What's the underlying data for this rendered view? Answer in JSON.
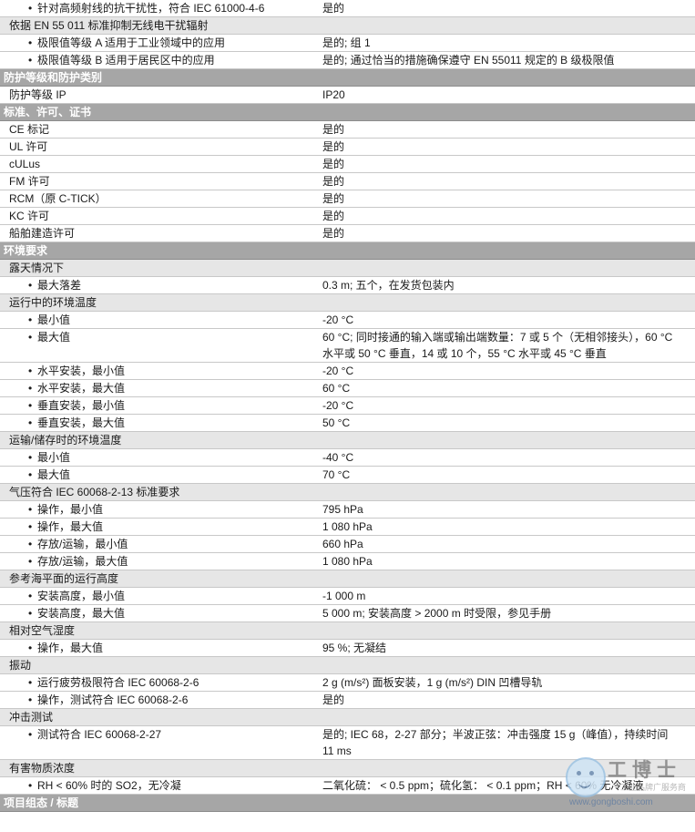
{
  "rows": [
    {
      "kind": "item",
      "label": "针对高频射线的抗干扰性，符合 IEC 61000-4-6",
      "value": "是的"
    },
    {
      "kind": "sub",
      "label": "依据 EN 55 011 标准抑制无线电干扰辐射",
      "value": ""
    },
    {
      "kind": "item",
      "label": "极限值等级 A 适用于工业领域中的应用",
      "value": "是的; 组 1"
    },
    {
      "kind": "item",
      "label": "极限值等级 B 适用于居民区中的应用",
      "value": "是的; 通过恰当的措施确保遵守 EN 55011 规定的 B 级极限值"
    },
    {
      "kind": "sec",
      "label": "防护等级和防护类别",
      "value": ""
    },
    {
      "kind": "plain",
      "label": "防护等级 IP",
      "value": "IP20"
    },
    {
      "kind": "sec",
      "label": "标准、许可、证书",
      "value": ""
    },
    {
      "kind": "plain",
      "label": "CE 标记",
      "value": "是的"
    },
    {
      "kind": "plain",
      "label": "UL 许可",
      "value": "是的"
    },
    {
      "kind": "plain",
      "label": "cULus",
      "value": "是的"
    },
    {
      "kind": "plain",
      "label": "FM 许可",
      "value": "是的"
    },
    {
      "kind": "plain",
      "label": "RCM（原 C-TICK）",
      "value": "是的"
    },
    {
      "kind": "plain",
      "label": "KC 许可",
      "value": "是的"
    },
    {
      "kind": "plain",
      "label": "船舶建造许可",
      "value": "是的"
    },
    {
      "kind": "sec",
      "label": "环境要求",
      "value": ""
    },
    {
      "kind": "sub",
      "label": "露天情况下",
      "value": ""
    },
    {
      "kind": "item",
      "label": "最大落差",
      "value": "0.3 m; 五个，在发货包装内"
    },
    {
      "kind": "sub",
      "label": "运行中的环境温度",
      "value": ""
    },
    {
      "kind": "item",
      "label": "最小值",
      "value": "-20 °C"
    },
    {
      "kind": "item",
      "label": "最大值",
      "value": "60 °C; 同时接通的输入端或输出端数量：7 或 5 个（无相邻接头），60 °C 水平或 50 °C 垂直，14 或 10 个，55 °C 水平或 45 °C 垂直"
    },
    {
      "kind": "item",
      "label": "水平安装，最小值",
      "value": "-20 °C"
    },
    {
      "kind": "item",
      "label": "水平安装，最大值",
      "value": "60 °C"
    },
    {
      "kind": "item",
      "label": "垂直安装，最小值",
      "value": "-20 °C"
    },
    {
      "kind": "item",
      "label": "垂直安装，最大值",
      "value": "50 °C"
    },
    {
      "kind": "sub",
      "label": "运输/储存时的环境温度",
      "value": ""
    },
    {
      "kind": "item",
      "label": "最小值",
      "value": "-40 °C"
    },
    {
      "kind": "item",
      "label": "最大值",
      "value": "70 °C"
    },
    {
      "kind": "sub",
      "label": "气压符合 IEC 60068-2-13 标准要求",
      "value": ""
    },
    {
      "kind": "item",
      "label": "操作，最小值",
      "value": "795 hPa"
    },
    {
      "kind": "item",
      "label": "操作，最大值",
      "value": "1 080 hPa"
    },
    {
      "kind": "item",
      "label": "存放/运输，最小值",
      "value": "660 hPa"
    },
    {
      "kind": "item",
      "label": "存放/运输，最大值",
      "value": "1 080 hPa"
    },
    {
      "kind": "sub",
      "label": "参考海平面的运行高度",
      "value": ""
    },
    {
      "kind": "item",
      "label": "安装高度，最小值",
      "value": "-1 000 m"
    },
    {
      "kind": "item",
      "label": "安装高度，最大值",
      "value": "5 000 m; 安装高度 > 2000 m 时受限，参见手册"
    },
    {
      "kind": "sub",
      "label": "相对空气湿度",
      "value": ""
    },
    {
      "kind": "item",
      "label": "操作，最大值",
      "value": "95 %; 无凝结"
    },
    {
      "kind": "sub",
      "label": "振动",
      "value": ""
    },
    {
      "kind": "item",
      "label": "运行疲劳极限符合 IEC 60068-2-6",
      "value": "2 g (m/s²) 面板安装，1 g (m/s²) DIN 凹槽导轨"
    },
    {
      "kind": "item",
      "label": "操作，测试符合 IEC 60068-2-6",
      "value": "是的"
    },
    {
      "kind": "sub",
      "label": "冲击测试",
      "value": ""
    },
    {
      "kind": "item",
      "label": "测试符合 IEC 60068-2-27",
      "value": "是的; IEC 68，2-27 部分；半波正弦：冲击强度 15 g（峰值），持续时间 11 ms"
    },
    {
      "kind": "sub",
      "label": "有害物质浓度",
      "value": ""
    },
    {
      "kind": "item",
      "label": "RH < 60% 时的 SO2，无冷凝",
      "value": "二氧化硫： < 0.5 ppm；硫化氢： < 0.1 ppm；RH < 60% 无冷凝液"
    },
    {
      "kind": "sec",
      "label": "项目组态 / 标题",
      "value": ""
    }
  ],
  "watermark": {
    "title": "工博士",
    "subtitle": "工业品牌广服务商",
    "url": "www.gongboshi.com"
  }
}
